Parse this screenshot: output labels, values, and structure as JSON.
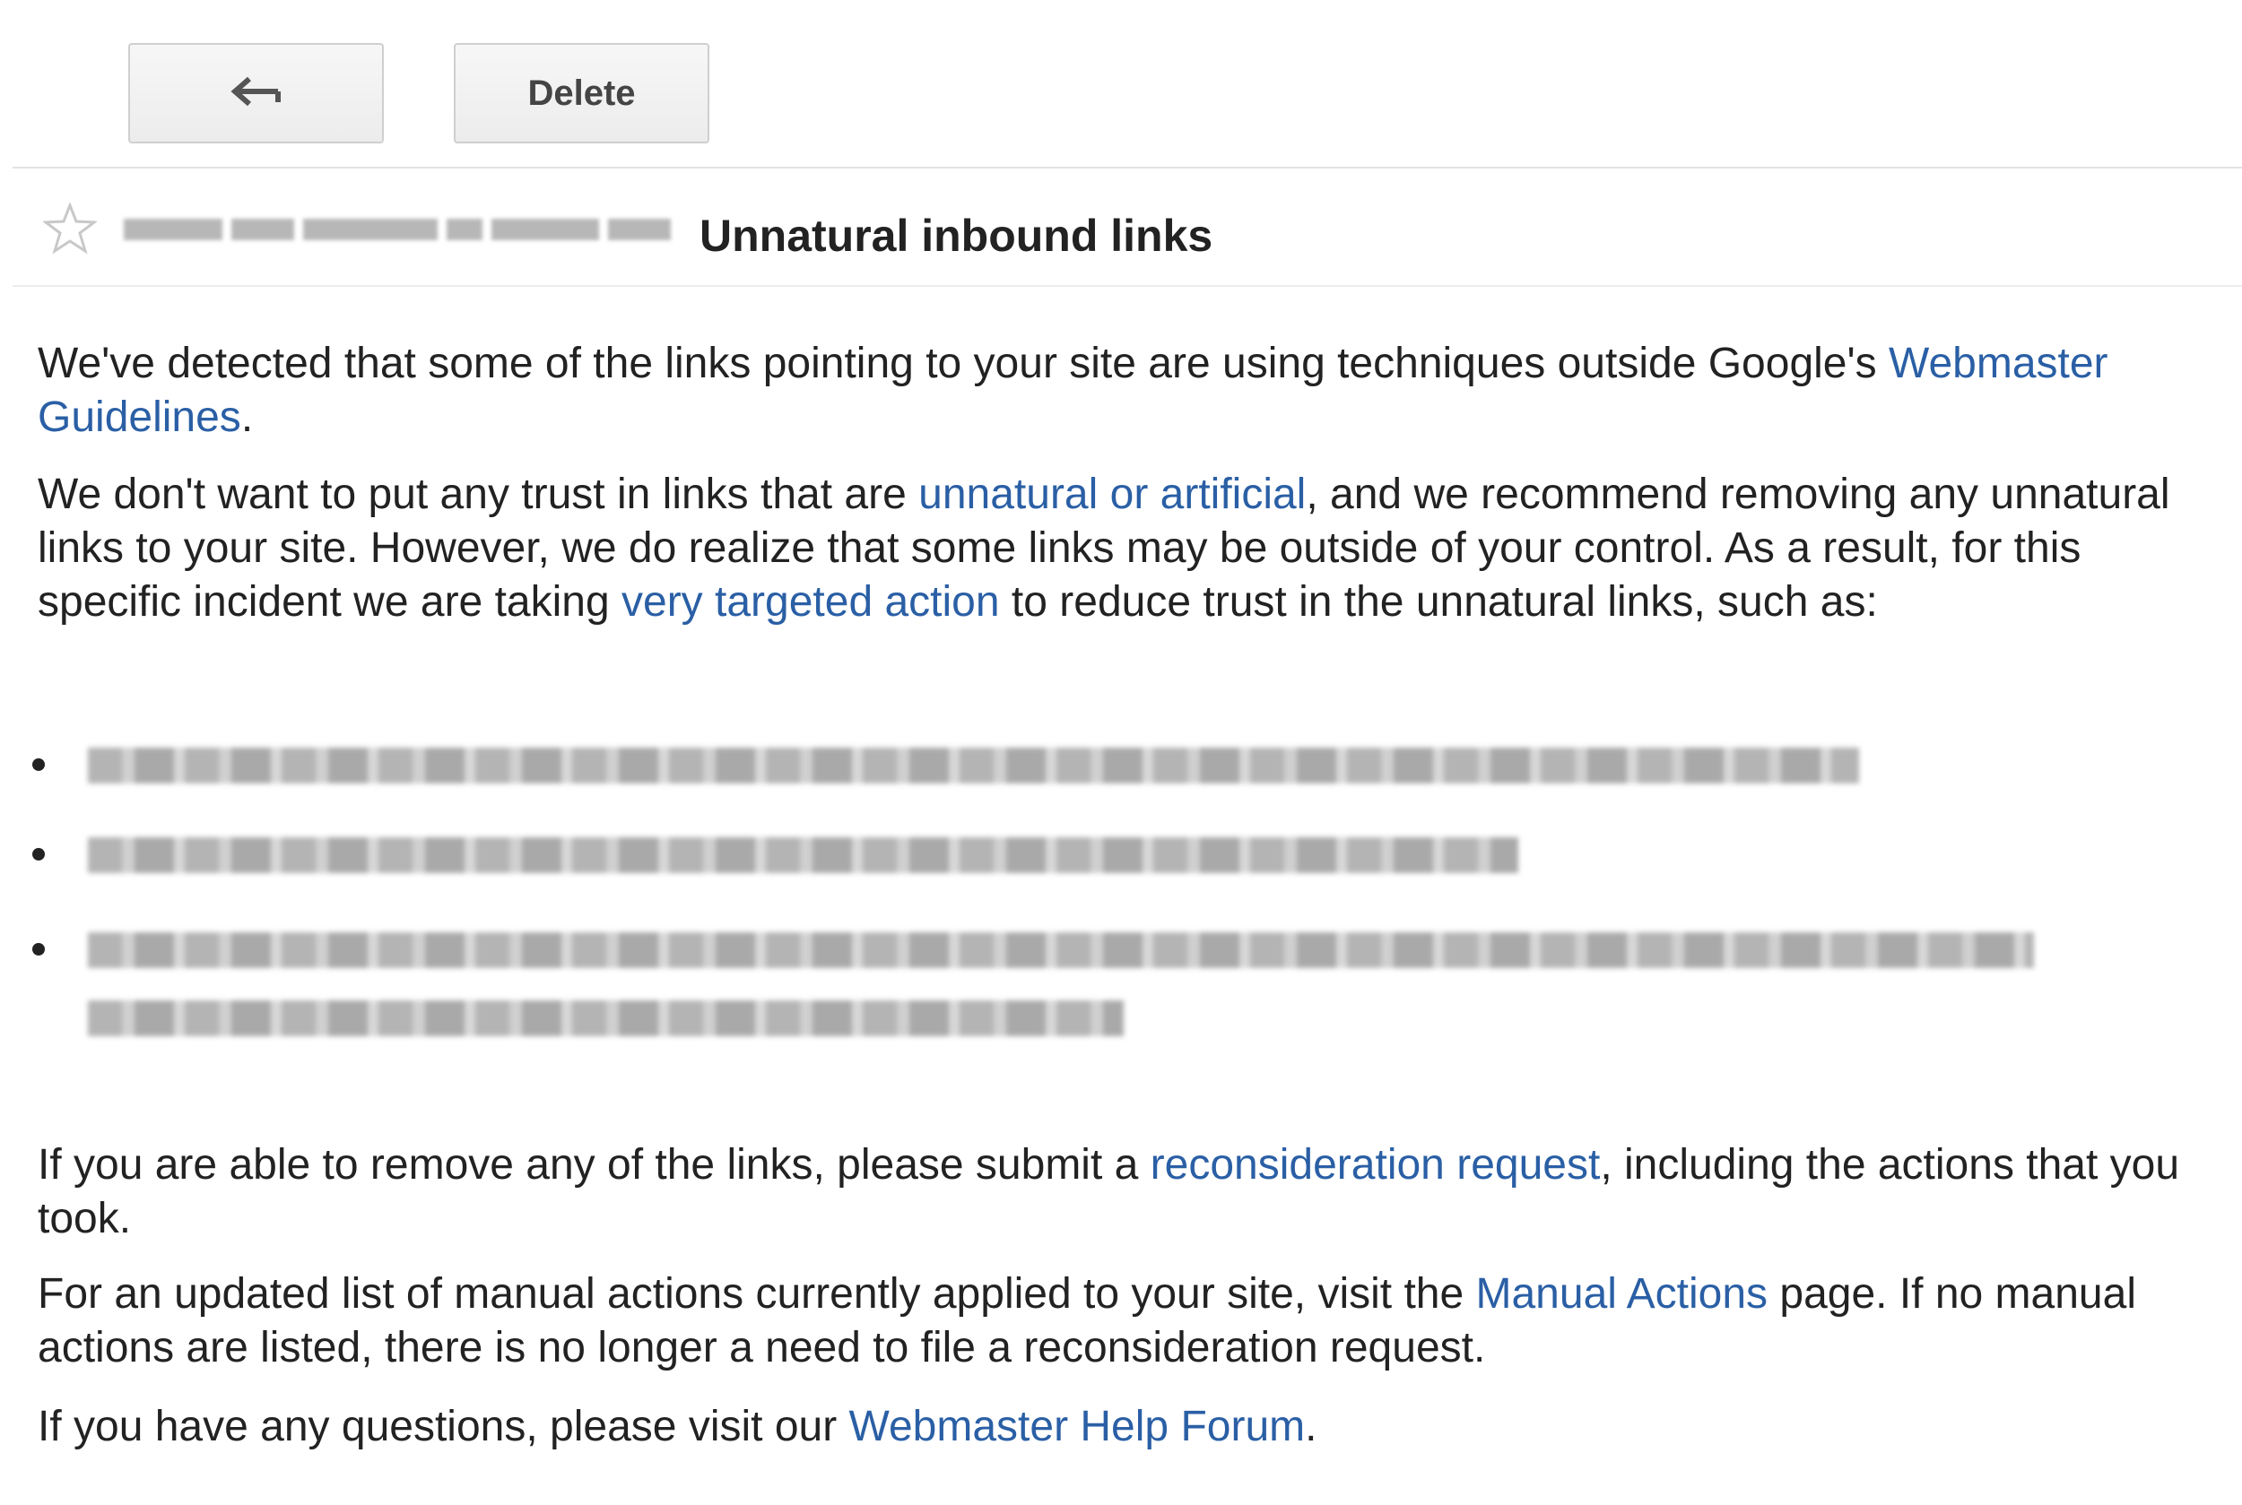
{
  "toolbar": {
    "reply_icon": "reply-arrow-icon",
    "delete_label": "Delete"
  },
  "message": {
    "star_icon": "star-outline-icon",
    "subject": "Unnatural inbound links",
    "para1": {
      "text_before": "We've detected that some of the links pointing to your site are using techniques outside Google's ",
      "link": "Webmaster Guidelines",
      "text_after": "."
    },
    "para2": {
      "text_a": "We don't want to put any trust in links that are ",
      "link_a": "unnatural or artificial",
      "text_b": ", and we recommend removing any unnatural links to your site. However, we do realize that some links may be outside of your control. As a result, for this specific incident we are taking ",
      "link_b": "very targeted action",
      "text_c": " to reduce trust in the unnatural links, such as:"
    },
    "para4": {
      "text_before": "If you are able to remove any of the links, please submit a ",
      "link": "reconsideration request",
      "text_after": ", including the actions that you took."
    },
    "para5": {
      "text_before": "For an updated list of manual actions currently applied to your site, visit the ",
      "link": "Manual Actions",
      "text_after": " page. If no manual actions are listed, there is no longer a need to file a reconsideration request."
    },
    "para6": {
      "text_before": "If you have any questions, please visit our ",
      "link": "Webmaster Help Forum",
      "text_after": "."
    }
  },
  "colors": {
    "link": "#2a5fa5",
    "text": "#222222",
    "button_border": "#cfcfcf"
  }
}
